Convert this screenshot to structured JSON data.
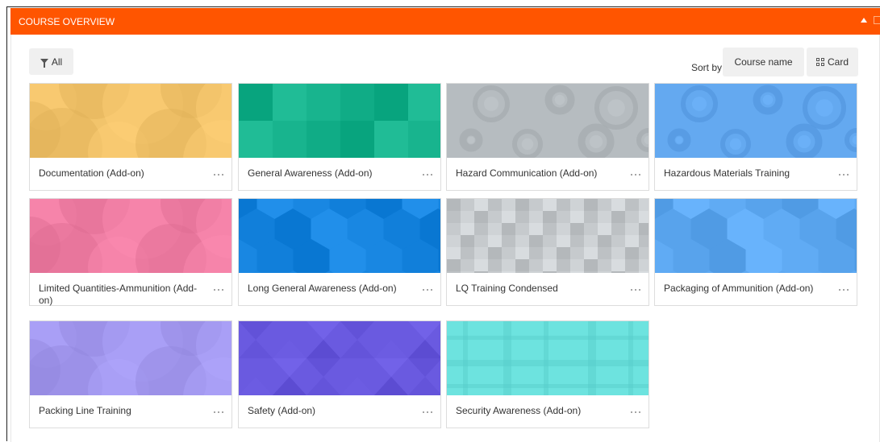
{
  "block": {
    "title": "COURSE OVERVIEW"
  },
  "toolbar": {
    "filter_label": "All",
    "sort_by_label": "Sort by",
    "sort_value": "Course name",
    "view_label": "Card"
  },
  "icons": {
    "filter": "filter-funnel-icon",
    "view": "card-grid-icon",
    "menu": "ellipsis-icon",
    "collapse": "caret-up-icon"
  },
  "colors": {
    "header": "#ff5500"
  },
  "courses": [
    {
      "name": "Documentation (Add-on)",
      "color": "#f2c46b",
      "pattern": "circles"
    },
    {
      "name": "General Awareness (Add-on)",
      "color": "#14b08a",
      "pattern": "squares"
    },
    {
      "name": "Hazard Communication (Add-on)",
      "color": "#b6bcc0",
      "pattern": "rings"
    },
    {
      "name": "Hazardous Materials Training",
      "color": "#64a9f0",
      "pattern": "rings"
    },
    {
      "name": "Limited Quantities-Ammunition (Add-on)",
      "color": "#f07fa5",
      "pattern": "circles"
    },
    {
      "name": "Long General Awareness (Add-on)",
      "color": "#1785e0",
      "pattern": "hex"
    },
    {
      "name": "LQ Training Condensed",
      "color": "#c4c8cb",
      "pattern": "mosaic"
    },
    {
      "name": "Packaging of Ammunition (Add-on)",
      "color": "#5ea9f2",
      "pattern": "hex"
    },
    {
      "name": "Packing Line Training",
      "color": "#a49af0",
      "pattern": "circles"
    },
    {
      "name": "Safety (Add-on)",
      "color": "#6a5ae0",
      "pattern": "triangles"
    },
    {
      "name": "Security Awareness (Add-on)",
      "color": "#6de3df",
      "pattern": "plaid"
    }
  ]
}
